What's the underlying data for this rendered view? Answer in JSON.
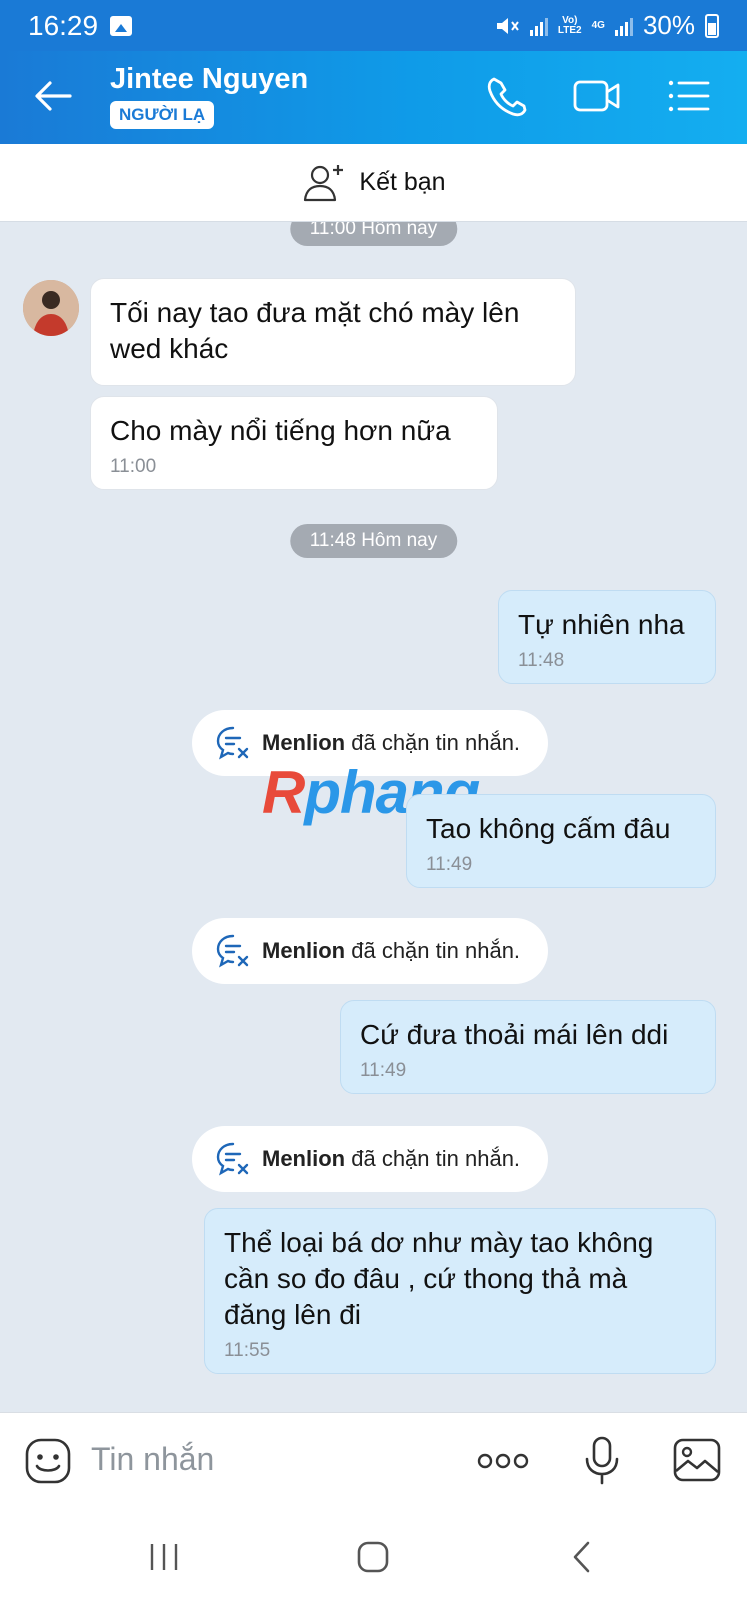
{
  "status": {
    "time": "16:29",
    "battery": "30%",
    "network": "4G",
    "lte": "LTE2",
    "volte": "Vo)"
  },
  "header": {
    "name": "Jintee Nguyen",
    "badge": "NGƯỜI LẠ"
  },
  "friend_bar": {
    "label": "Kết bạn"
  },
  "messages": [
    {
      "type": "time",
      "text": "11:00 Hôm nay"
    },
    {
      "type": "in",
      "text": "Tối nay tao đưa mặt chó mày lên wed khác"
    },
    {
      "type": "in",
      "text": "Cho mày nổi tiếng hơn nữa",
      "time": "11:00"
    },
    {
      "type": "time",
      "text": "11:48 Hôm nay"
    },
    {
      "type": "out",
      "text": "Tự nhiên nha",
      "time": "11:48"
    },
    {
      "type": "blocked",
      "name": "Menlion",
      "text": "đã chặn tin nhắn."
    },
    {
      "type": "out",
      "text": "Tao không cấm đâu",
      "time": "11:49"
    },
    {
      "type": "blocked",
      "name": "Menlion",
      "text": "đã chặn tin nhắn."
    },
    {
      "type": "out",
      "text": "Cứ đưa thoải mái lên ddi",
      "time": "11:49"
    },
    {
      "type": "blocked",
      "name": "Menlion",
      "text": "đã chặn tin nhắn."
    },
    {
      "type": "out",
      "text": "Thể loại bá dơ như mày tao không cần so đo đâu , cứ thong thả mà đăng lên đi",
      "time": "11:55"
    }
  ],
  "watermark": {
    "first": "R",
    "rest": "phang"
  },
  "input": {
    "placeholder": "Tin nhắn"
  },
  "icons": [
    "back-arrow-icon",
    "phone-icon",
    "video-call-icon",
    "menu-list-icon",
    "add-friend-icon",
    "blocked-message-icon",
    "emoji-icon",
    "more-icon",
    "microphone-icon",
    "image-icon",
    "recent-apps-icon",
    "home-icon",
    "nav-back-icon"
  ],
  "colors": {
    "header_start": "#1a7ad6",
    "header_end": "#14aef0",
    "chat_bg": "#e2e9f1",
    "outgoing_bubble": "#d6ecfb",
    "incoming_bubble": "#ffffff",
    "accent": "#1a7ad6"
  }
}
